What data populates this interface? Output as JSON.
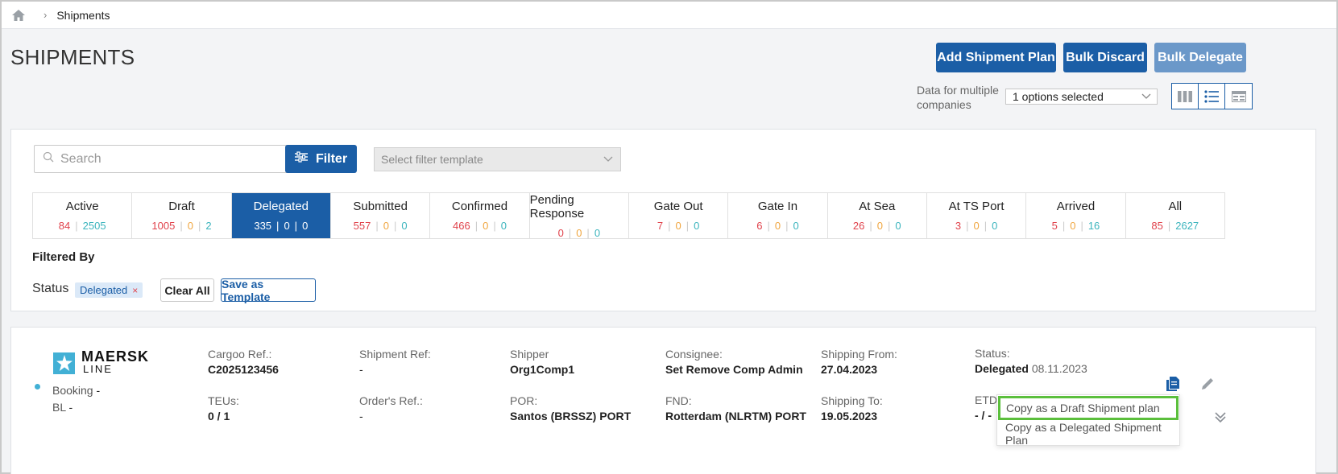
{
  "breadcrumb": {
    "home_icon": "home-icon",
    "current": "Shipments"
  },
  "header": {
    "title": "SHIPMENTS",
    "add_plan_label": "Add Shipment Plan",
    "bulk_discard_label": "Bulk Discard",
    "bulk_delegate_label": "Bulk Delegate",
    "companies_label": "Data for multiple companies",
    "companies_value": "1 options selected",
    "view_modes": [
      "columns-view-icon",
      "list-view-icon",
      "card-view-icon"
    ]
  },
  "filters": {
    "search_placeholder": "Search",
    "filter_label": "Filter",
    "template_placeholder": "Select filter template",
    "filtered_by_label": "Filtered By",
    "status_label": "Status",
    "status_chip": "Delegated",
    "status_chip_remove": "×",
    "clear_all_label": "Clear All",
    "save_template_label": "Save as Template"
  },
  "status_tabs": [
    {
      "label": "Active",
      "counts": [
        "84",
        "2505"
      ],
      "colors": [
        "red",
        "teal"
      ]
    },
    {
      "label": "Draft",
      "counts": [
        "1005",
        "0",
        "2"
      ],
      "colors": [
        "red",
        "orange",
        "teal"
      ]
    },
    {
      "label": "Delegated",
      "counts": [
        "335",
        "0",
        "0"
      ],
      "colors": [
        "red",
        "orange",
        "teal"
      ],
      "active": true
    },
    {
      "label": "Submitted",
      "counts": [
        "557",
        "0",
        "0"
      ],
      "colors": [
        "red",
        "orange",
        "teal"
      ]
    },
    {
      "label": "Confirmed",
      "counts": [
        "466",
        "0",
        "0"
      ],
      "colors": [
        "red",
        "orange",
        "teal"
      ]
    },
    {
      "label": "Pending Response",
      "counts": [
        "0",
        "0",
        "0"
      ],
      "colors": [
        "red",
        "orange",
        "teal"
      ]
    },
    {
      "label": "Gate Out",
      "counts": [
        "7",
        "0",
        "0"
      ],
      "colors": [
        "red",
        "orange",
        "teal"
      ]
    },
    {
      "label": "Gate In",
      "counts": [
        "6",
        "0",
        "0"
      ],
      "colors": [
        "red",
        "orange",
        "teal"
      ]
    },
    {
      "label": "At Sea",
      "counts": [
        "26",
        "0",
        "0"
      ],
      "colors": [
        "red",
        "orange",
        "teal"
      ]
    },
    {
      "label": "At TS Port",
      "counts": [
        "3",
        "0",
        "0"
      ],
      "colors": [
        "red",
        "orange",
        "teal"
      ]
    },
    {
      "label": "Arrived",
      "counts": [
        "5",
        "0",
        "16"
      ],
      "colors": [
        "red",
        "orange",
        "teal"
      ]
    },
    {
      "label": "All",
      "counts": [
        "85",
        "2627"
      ],
      "colors": [
        "red",
        "teal"
      ]
    }
  ],
  "shipment": {
    "carrier_line1": "MAERSK",
    "carrier_line2": "LINE",
    "booking_label": "Booking",
    "booking_value": "-",
    "bl_label": "BL",
    "bl_value": "-",
    "cargoo_ref_label": "Cargoo Ref.:",
    "cargoo_ref": "C2025123456",
    "teus_label": "TEUs:",
    "teus": "0 / 1",
    "shipment_ref_label": "Shipment Ref:",
    "shipment_ref": "-",
    "orders_ref_label": "Order's Ref.:",
    "orders_ref": "-",
    "shipper_label": "Shipper",
    "shipper": "Org1Comp1",
    "por_label": "POR:",
    "por": "Santos (BRSSZ) PORT",
    "consignee_label": "Consignee:",
    "consignee": "Set Remove Comp Admin",
    "fnd_label": "FND:",
    "fnd": "Rotterdam (NLRTM) PORT",
    "shipping_from_label": "Shipping From:",
    "shipping_from": "27.04.2023",
    "shipping_to_label": "Shipping To:",
    "shipping_to": "19.05.2023",
    "status_label": "Status:",
    "status": "Delegated",
    "status_date": "08.11.2023",
    "etd_label": "ETD",
    "etd": "- / -"
  },
  "copy_menu": {
    "draft_label": "Copy as a Draft Shipment plan",
    "delegated_label": "Copy as a Delegated Shipment Plan"
  },
  "colors": {
    "brand_blue": "#1b5ea6",
    "red": "#e0424b",
    "orange": "#f0a640",
    "teal": "#3bb4bd",
    "highlight": "#5bbf3c"
  }
}
